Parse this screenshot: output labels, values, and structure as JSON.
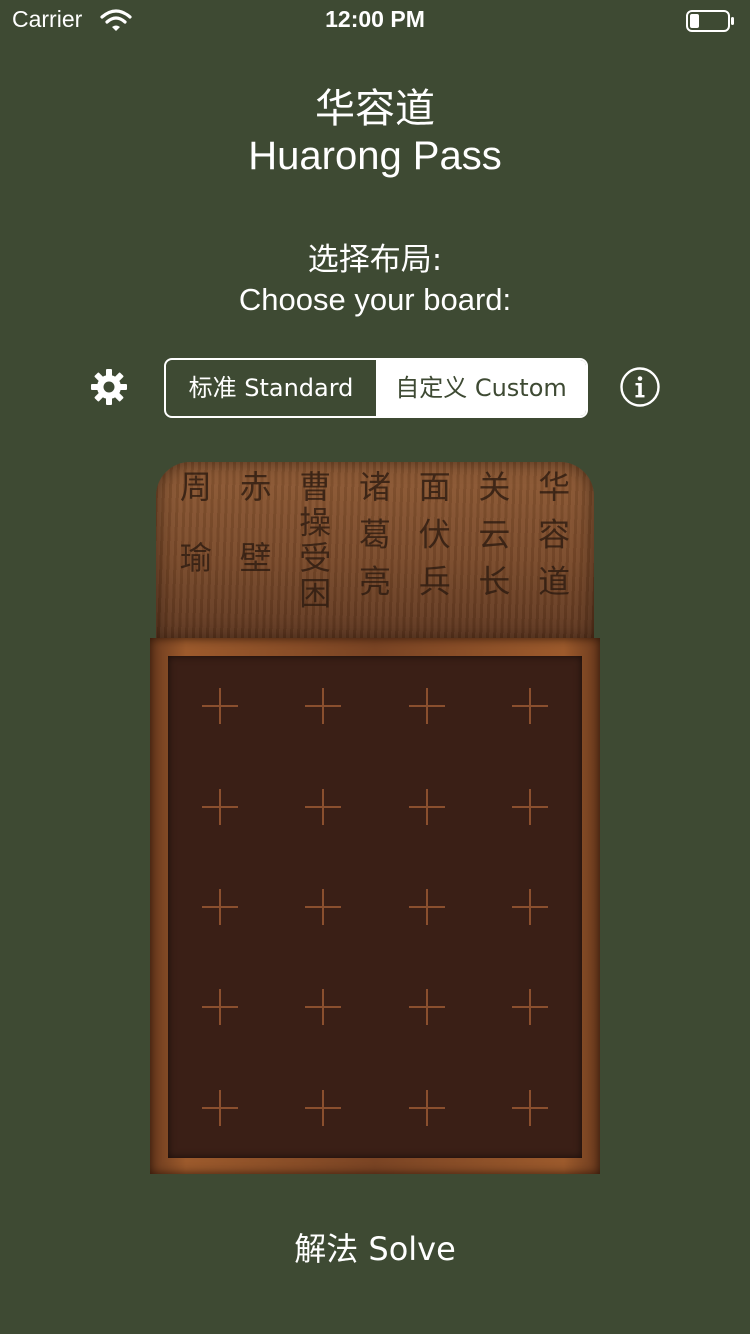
{
  "status_bar": {
    "carrier": "Carrier",
    "time": "12:00 PM",
    "battery_level": 0.2
  },
  "header": {
    "title_cn": "华容道",
    "title_en": "Huarong Pass"
  },
  "prompt": {
    "line_cn": "选择布局:",
    "line_en": "Choose your board:"
  },
  "segmented_control": {
    "options": [
      "标准 Standard",
      "自定义 Custom"
    ],
    "selected": "自定义 Custom"
  },
  "board": {
    "inscription_columns": [
      "华容道",
      "关云长",
      "面伏兵",
      "诸葛亮",
      "曹操受困",
      "赤壁",
      "周瑜"
    ],
    "rows": 5,
    "cols": 4
  },
  "actions": {
    "solve_label": "解法 Solve"
  },
  "colors": {
    "background": "#3e4a33",
    "board_surface": "#3a1f16",
    "grid_marker": "#8a4f2e",
    "wood": "#8e5a34"
  },
  "icons": {
    "settings": "gear-icon",
    "info": "info-icon"
  }
}
